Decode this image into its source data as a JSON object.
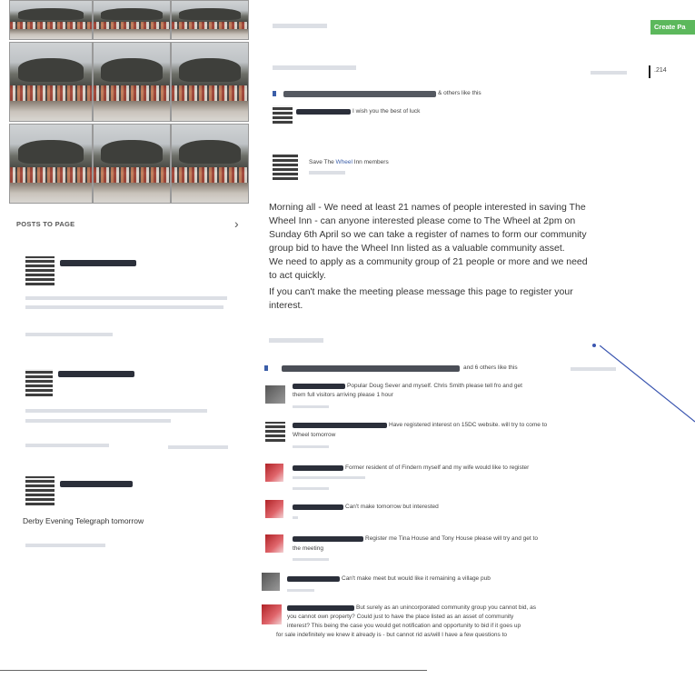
{
  "header": {
    "create_button": "Create Pa",
    "count": ".214"
  },
  "sidebar": {
    "section_title": "POSTS TO PAGE",
    "chevron": "›",
    "post_texts": [
      "Derby Evening Telegraph tomorrow"
    ]
  },
  "main": {
    "first_likes": "& others like this",
    "comment1": "I wish you the best of luck",
    "poster_line": "Save The Wheel Inn members",
    "poster_link": "Wheel",
    "post_lines": [
      "Morning all - We need at least 21 names of people interested in saving The",
      "Wheel Inn - can anyone interested please come to The Wheel at 2pm on",
      "Sunday 6th April so we can take a register of names to form our community",
      "group bid to have the Wheel Inn listed as a valuable community asset.",
      "We need to apply as a community group of 21 people or more and we need",
      "to act quickly.",
      "If you can't make the meeting please message this page to register your",
      "interest."
    ],
    "second_likes": "and 6 others like this",
    "comments": [
      {
        "lines": [
          "Popular Doug Sever and myself. Chris Smith please tell fro and get",
          "them full visitors arriving please 1 hour"
        ]
      },
      {
        "lines": [
          "Have registered interest on 15DC website. will try to come to",
          "Wheel tomorrow"
        ]
      },
      {
        "lines": [
          "Former resident of of Findern myself and my wife would like to register"
        ]
      },
      {
        "lines": [
          "Can't make tomorrow but interested"
        ]
      },
      {
        "lines": [
          "Register me Tina House and Tony House please will try and get to",
          "the meeting"
        ]
      },
      {
        "lines": [
          "Can't make meet but would like it remaining a village pub"
        ]
      },
      {
        "lines": [
          "But surely as an unincorporated community group you cannot bid, as",
          "you cannot own property? Could just to have the place listed as an asset of community",
          "interest? This being the case you would get notification and opportunity to bid if it goes up",
          "for sale indefinitely we knew it already is - but cannot rid as/will I have a few questions to"
        ]
      }
    ]
  },
  "colors": {
    "create_button_bg": "#5cb85c",
    "link": "#3b5ea8",
    "annotation_line": "#3a55b0"
  },
  "icons": [
    "chevron-right-icon"
  ]
}
